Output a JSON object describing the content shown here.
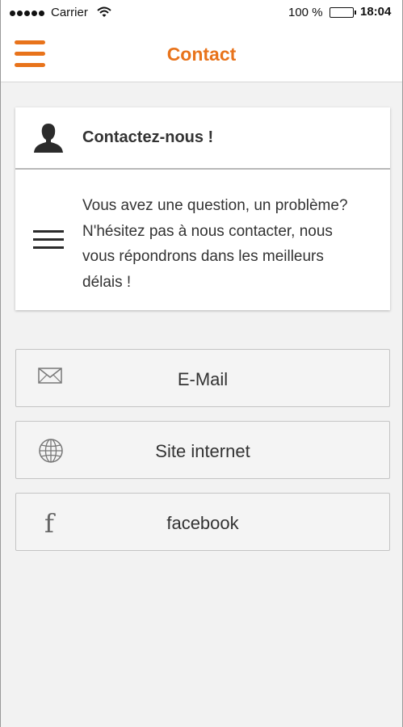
{
  "status_bar": {
    "carrier": "Carrier",
    "battery": "100 %",
    "time": "18:04"
  },
  "nav": {
    "title": "Contact",
    "accent_color": "#e8731b"
  },
  "card": {
    "title": "Contactez-nous !",
    "text": "Vous avez une question, un problème? N'hésitez pas à nous contacter, nous vous répondrons dans les meilleurs délais !",
    "header_icon": "user-icon",
    "body_icon": "text-lines-icon"
  },
  "actions": [
    {
      "label": "E-Mail",
      "icon": "mail-icon"
    },
    {
      "label": "Site internet",
      "icon": "globe-icon"
    },
    {
      "label": "facebook",
      "icon": "facebook-icon"
    }
  ]
}
